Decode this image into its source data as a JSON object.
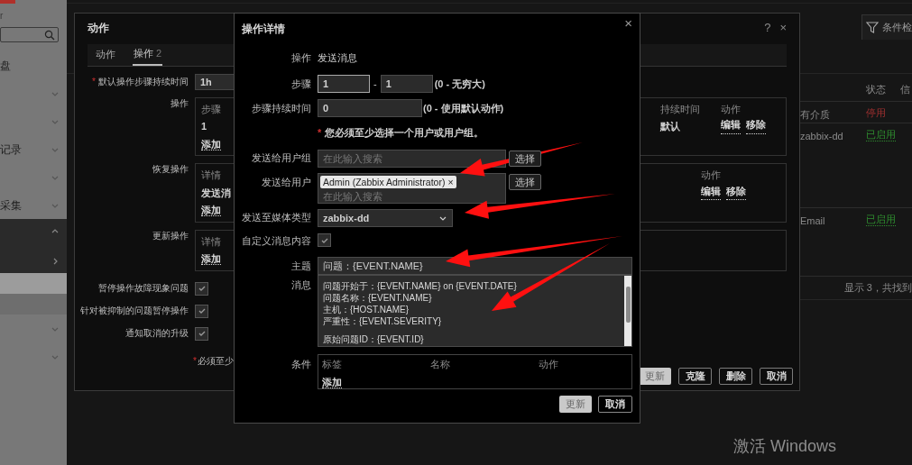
{
  "sidebar": {
    "server_fragment": "r",
    "items": [
      {
        "label": "盘",
        "kind": "link"
      },
      {
        "kind": "group",
        "expanded": false
      },
      {
        "kind": "group",
        "expanded": false
      },
      {
        "label": "记录",
        "kind": "group",
        "expanded": false
      },
      {
        "kind": "group",
        "expanded": false
      },
      {
        "label": "采集",
        "kind": "group",
        "expanded": false
      },
      {
        "kind": "group",
        "expanded": true
      },
      {
        "kind": "submenu"
      },
      {
        "kind": "link",
        "selected": true
      },
      {
        "kind": "link",
        "selected": false
      },
      {
        "kind": "group",
        "expanded": false
      },
      {
        "kind": "group",
        "expanded": false
      }
    ]
  },
  "page": {
    "filter_tab": "条件检",
    "table": {
      "columns": [
        "状态",
        "信"
      ],
      "rows": [
        {
          "column_1": "有介质",
          "status": "停用",
          "enabled": false
        },
        {
          "column_1": "zabbix-dd",
          "status": "已启用",
          "enabled": true
        },
        {
          "column_1": "Email",
          "status": "已启用",
          "enabled": true
        }
      ]
    },
    "footer": "显示 3，共找到"
  },
  "action_dialog": {
    "title": "动作",
    "help": "?",
    "close": "×",
    "tabs": [
      {
        "label": "动作",
        "selected": false
      },
      {
        "label": "操作",
        "count": "2",
        "selected": true
      }
    ],
    "default_step_duration": {
      "label": "默认操作步骤持续时间",
      "required_mark": "*",
      "value": "1h"
    },
    "operations": {
      "label": "操作",
      "columns": [
        "步骤",
        "持续时间",
        "动作"
      ],
      "rows": [
        {
          "step": "1",
          "duration": "默认",
          "actions": [
            "编辑",
            "移除"
          ]
        }
      ],
      "add": "添加"
    },
    "recovery_operations": {
      "label": "恢复操作",
      "columns": [
        "详情",
        "动作"
      ],
      "rows": [
        {
          "details": "发送消",
          "actions": [
            "编辑",
            "移除"
          ]
        }
      ],
      "add": "添加"
    },
    "update_operations": {
      "label": "更新操作",
      "columns": [
        "详情"
      ],
      "add": "添加"
    },
    "checkboxes": [
      {
        "label": "暂停操作故障现象问题",
        "checked": true
      },
      {
        "label": "针对被抑制的问题暂停操作",
        "checked": true
      },
      {
        "label": "通知取消的升级",
        "checked": true
      }
    ],
    "required_note": {
      "mark": "*",
      "text": "必须至少"
    },
    "buttons": [
      {
        "label": "更新",
        "kind": "primary"
      },
      {
        "label": "克隆",
        "kind": "secondary"
      },
      {
        "label": "删除",
        "kind": "secondary"
      },
      {
        "label": "取消",
        "kind": "secondary"
      }
    ]
  },
  "details_dialog": {
    "title": "操作详情",
    "close": "×",
    "operation": {
      "label": "操作",
      "value": "发送消息"
    },
    "steps": {
      "label": "步骤",
      "from": "1",
      "separator": "-",
      "to": "1",
      "hint": "(0 - 无穷大)"
    },
    "step_duration": {
      "label": "步骤持续时间",
      "value": "0",
      "hint": "(0 - 使用默认动作)"
    },
    "required_note": {
      "mark": "*",
      "text": "您必须至少选择一个用户或用户组。"
    },
    "user_groups": {
      "label": "发送给用户组",
      "placeholder": "在此输入搜索",
      "button": "选择"
    },
    "users": {
      "label": "发送给用户",
      "tags": [
        "Admin (Zabbix Administrator)"
      ],
      "tag_remove": "×",
      "placeholder": "在此输入搜索",
      "button": "选择"
    },
    "media_type": {
      "label": "发送至媒体类型",
      "value": "zabbix-dd"
    },
    "custom_message": {
      "label": "自定义消息内容",
      "checked": true
    },
    "subject": {
      "label": "主题",
      "value": "问题：{EVENT.NAME}"
    },
    "message": {
      "label": "消息",
      "paragraphs": [
        [
          "问题开始于：{EVENT.NAME} on {EVENT.DATE}",
          "问题名称：{EVENT.NAME}",
          "主机：{HOST.NAME}",
          "严重性：{EVENT.SEVERITY}"
        ],
        [
          "原始问题ID：{EVENT.ID}"
        ]
      ]
    },
    "conditions": {
      "label": "条件",
      "columns": [
        "标签",
        "名称",
        "动作"
      ],
      "add": "添加"
    },
    "buttons": [
      {
        "label": "更新",
        "kind": "primary"
      },
      {
        "label": "取消",
        "kind": "secondary"
      }
    ]
  },
  "os_notice": "激活 Windows"
}
